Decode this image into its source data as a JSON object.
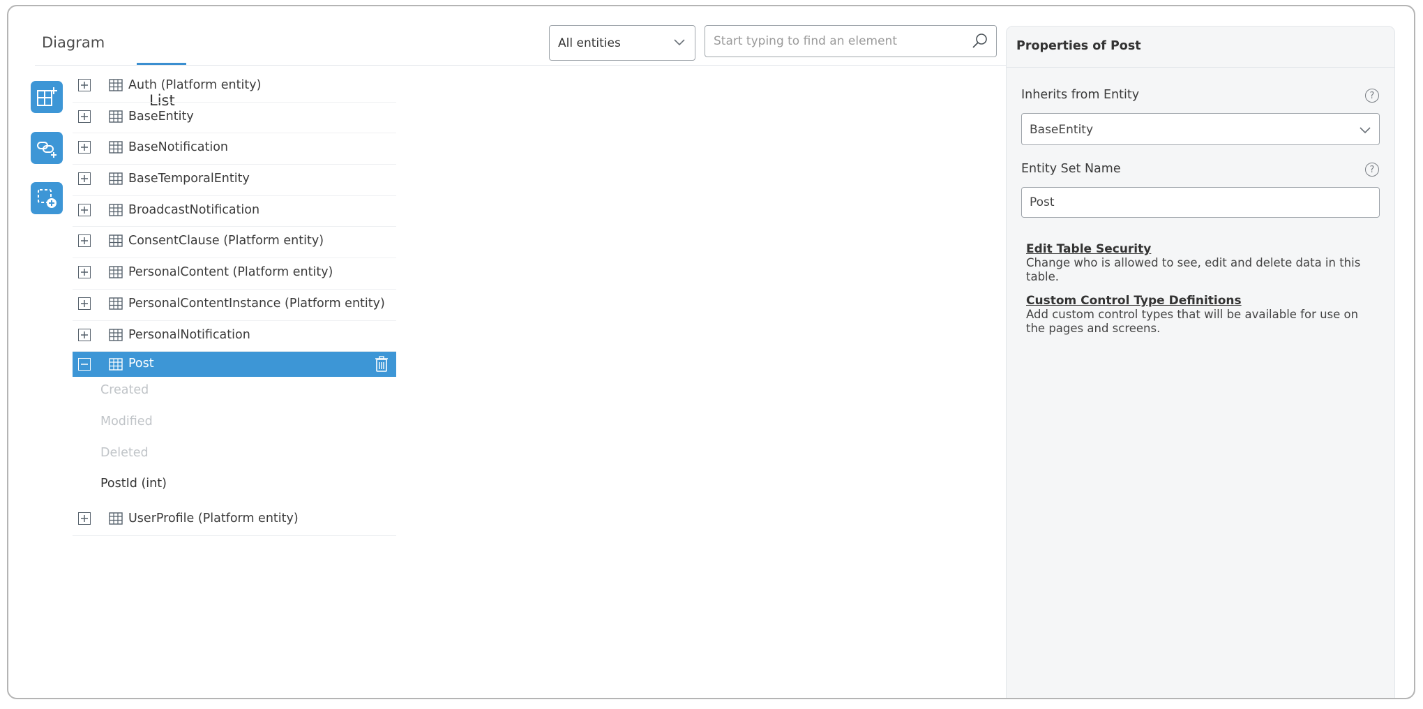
{
  "tabs": {
    "diagram": "Diagram",
    "list": "List",
    "active": "list"
  },
  "filter": {
    "value": "All entities"
  },
  "search": {
    "placeholder": "Start typing to find an element",
    "value": ""
  },
  "toolbar": {
    "tools": [
      {
        "name": "add-entity-tool",
        "icon": "add-table-icon"
      },
      {
        "name": "add-relation-tool",
        "icon": "link-add-icon"
      },
      {
        "name": "add-selection-tool",
        "icon": "dashed-select-add-icon"
      }
    ]
  },
  "entities": [
    {
      "label": "Auth (Platform entity)",
      "expanded": false
    },
    {
      "label": "BaseEntity",
      "expanded": false
    },
    {
      "label": "BaseNotification",
      "expanded": false
    },
    {
      "label": "BaseTemporalEntity",
      "expanded": false
    },
    {
      "label": "BroadcastNotification",
      "expanded": false
    },
    {
      "label": "ConsentClause (Platform entity)",
      "expanded": false
    },
    {
      "label": "PersonalContent (Platform entity)",
      "expanded": false
    },
    {
      "label": "PersonalContentInstance (Platform entity)",
      "expanded": false
    },
    {
      "label": "PersonalNotification",
      "expanded": false
    },
    {
      "label": "Post",
      "expanded": true,
      "selected": true,
      "attributes": [
        {
          "label": "Created",
          "inherited": true
        },
        {
          "label": "Modified",
          "inherited": true
        },
        {
          "label": "Deleted",
          "inherited": true
        },
        {
          "label": "PostId (int)",
          "inherited": false
        }
      ]
    },
    {
      "label": "UserProfile (Platform entity)",
      "expanded": false
    }
  ],
  "properties": {
    "title": "Properties of Post",
    "inherits_label": "Inherits from Entity",
    "inherits_value": "BaseEntity",
    "entity_set_label": "Entity Set Name",
    "entity_set_value": "Post",
    "help_glyph": "?",
    "links": [
      {
        "title": "Edit Table Security",
        "desc": "Change who is allowed to see, edit and delete data in this table."
      },
      {
        "title": "Custom Control Type Definitions",
        "desc": "Add custom control types that will be available for use on the pages and screens."
      }
    ]
  },
  "colors": {
    "accent": "#3d96d6",
    "selected_row": "#3d96d6",
    "border": "#9ea4aa",
    "panel_bg": "#f5f6f7"
  }
}
